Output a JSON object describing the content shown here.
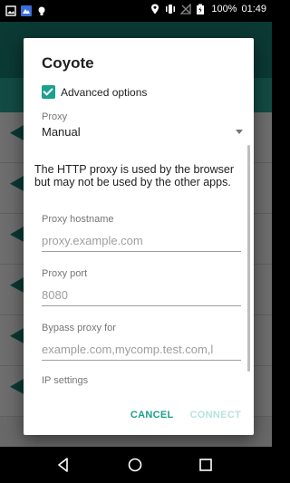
{
  "status_bar": {
    "battery_text": "100%",
    "time": "01:49"
  },
  "dialog": {
    "title": "Coyote",
    "advanced_options_label": "Advanced options",
    "advanced_options_checked": true,
    "proxy": {
      "label": "Proxy",
      "selected": "Manual"
    },
    "note": "The HTTP proxy is used by the browser but may not be used by the other apps.",
    "hostname": {
      "label": "Proxy hostname",
      "placeholder": "proxy.example.com"
    },
    "port": {
      "label": "Proxy port",
      "placeholder": "8080"
    },
    "bypass": {
      "label": "Bypass proxy for",
      "placeholder": "example.com,mycomp.test.com,l"
    },
    "ip_settings_label": "IP settings",
    "cancel_label": "CANCEL",
    "connect_label": "CONNECT"
  },
  "colors": {
    "accent": "#1a9e8d",
    "accent_disabled": "#b6e3dc",
    "toolbar": "#1a7e73"
  },
  "nav_bar": {
    "back_icon": "back-triangle-icon",
    "home_icon": "home-circle-icon",
    "recents_icon": "recents-square-icon"
  }
}
